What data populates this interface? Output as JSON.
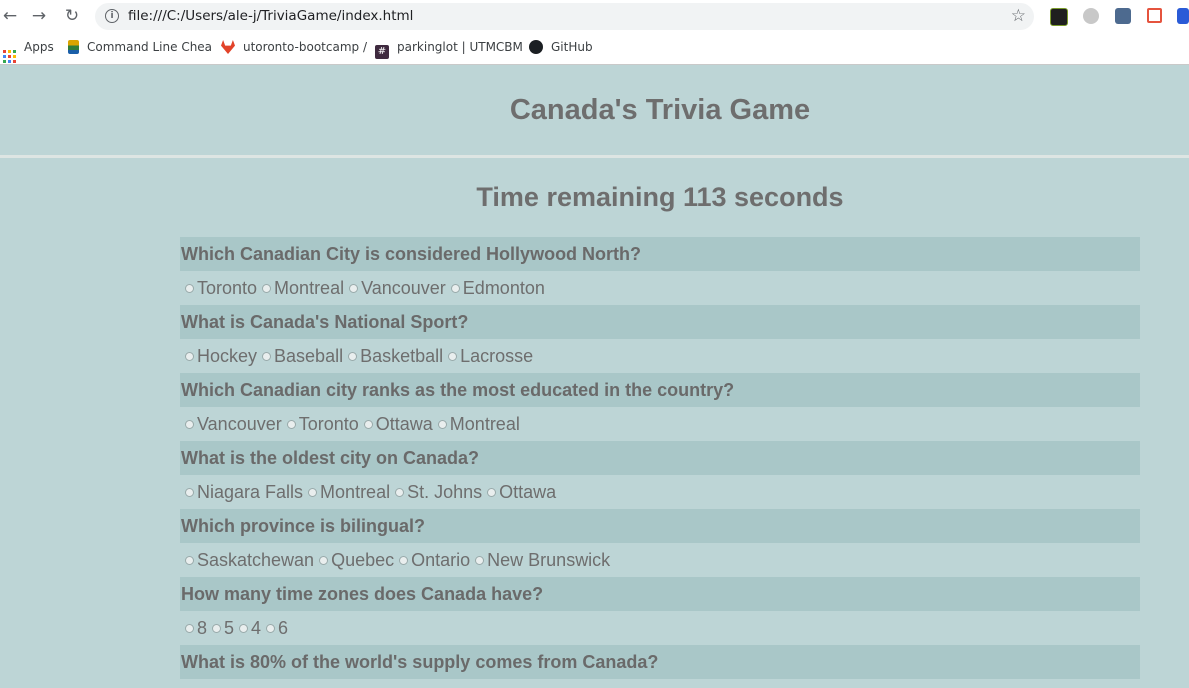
{
  "browser": {
    "url": "file:///C:/Users/ale-j/TriviaGame/index.html",
    "bookmarks": [
      {
        "label": "Apps",
        "icon": "apps-grid-icon"
      },
      {
        "label": "Command Line Chea",
        "icon": "command-line-icon"
      },
      {
        "label": "utoronto-bootcamp /",
        "icon": "gitlab-icon"
      },
      {
        "label": "parkinglot | UTMCBM",
        "icon": "slack-hash-icon"
      },
      {
        "label": "GitHub",
        "icon": "github-icon"
      }
    ],
    "extensions": [
      "extension-target-icon",
      "extension-gray-icon",
      "extension-puzzle-icon",
      "extension-red-icon",
      "extension-blue-icon"
    ]
  },
  "game": {
    "title": "Canada's Trivia Game",
    "timer": "Time remaining 113 seconds",
    "questions": [
      {
        "q": "Which Canadian City is considered Hollywood North?",
        "options": [
          "Toronto",
          "Montreal",
          "Vancouver",
          "Edmonton"
        ]
      },
      {
        "q": "What is Canada's National Sport?",
        "options": [
          "Hockey",
          "Baseball",
          "Basketball",
          "Lacrosse"
        ]
      },
      {
        "q": "Which Canadian city ranks as the most educated in the country?",
        "options": [
          "Vancouver",
          "Toronto",
          "Ottawa",
          "Montreal"
        ]
      },
      {
        "q": "What is the oldest city on Canada?",
        "options": [
          "Niagara Falls",
          "Montreal",
          "St. Johns",
          "Ottawa"
        ]
      },
      {
        "q": "Which province is bilingual?",
        "options": [
          "Saskatchewan",
          "Quebec",
          "Ontario",
          "New Brunswick"
        ]
      },
      {
        "q": "How many time zones does Canada have?",
        "options": [
          "8",
          "5",
          "4",
          "6"
        ]
      },
      {
        "q": "What is 80% of the world's supply comes from Canada?",
        "options": []
      }
    ]
  }
}
